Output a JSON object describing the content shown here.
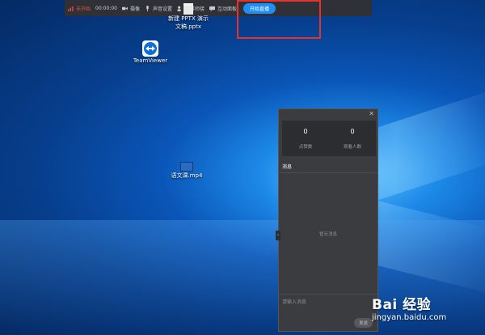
{
  "toolbar": {
    "status_label": "未开始",
    "timer": "00:00:00",
    "record_label": "摄像",
    "audio_label": "声音设置",
    "multi_label": "多讲师接",
    "interact_label": "互动面板",
    "start_label": "开始直播"
  },
  "desktop": {
    "pptx_label": "新建 PPTX 演示文稿.pptx",
    "teamviewer_label": "TeamViewer",
    "video_label": "语文课.mp4"
  },
  "panel": {
    "likes_value": "0",
    "likes_label": "点赞数",
    "viewers_value": "0",
    "viewers_label": "观看人数",
    "messages_header": "消息",
    "empty_text": "暂无消息",
    "input_placeholder": "请输入消息",
    "send_label": "发送"
  },
  "watermark": {
    "logo": "Bai 经验",
    "url": "jingyan.baidu.com"
  },
  "colors": {
    "toolbar_bg": "#2f3136",
    "start_button": "#1f8ff5",
    "status_red": "#e7513e",
    "highlight_red": "#e5322b",
    "panel_bg": "#3a3c40"
  }
}
